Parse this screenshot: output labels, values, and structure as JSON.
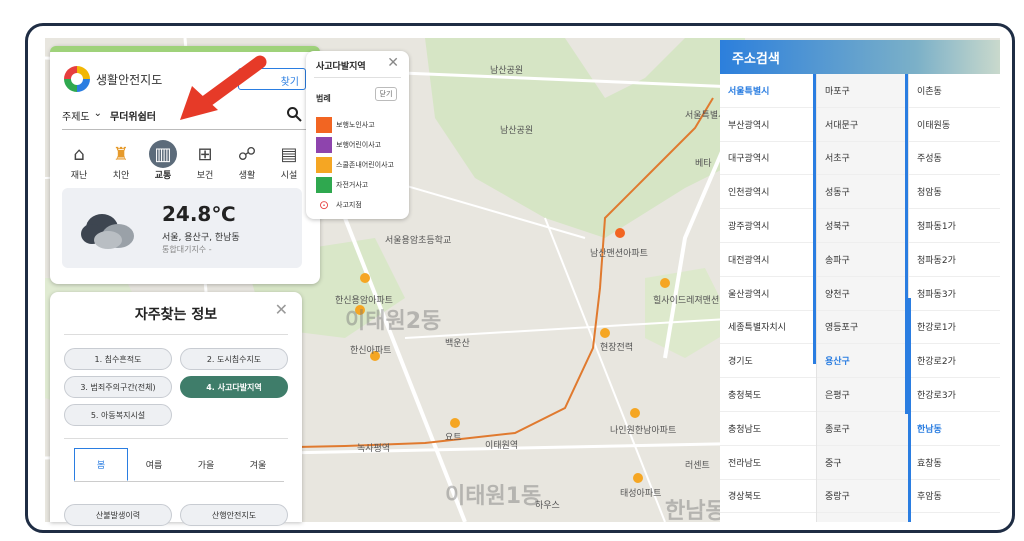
{
  "map": {
    "labels": [
      {
        "text": "남산공원"
      },
      {
        "text": "남산공원"
      },
      {
        "text": "서울특별시"
      },
      {
        "text": "베타"
      },
      {
        "text": "서울용암초등학교"
      },
      {
        "text": "남산맨션아파트"
      },
      {
        "text": "힐사이드레져맨션"
      },
      {
        "text": "한신용암아파트"
      },
      {
        "text": "이태원2동"
      },
      {
        "text": "백운산"
      },
      {
        "text": "한신아파트"
      },
      {
        "text": "현장전력"
      },
      {
        "text": "녹사평역"
      },
      {
        "text": "이태원역"
      },
      {
        "text": "요트"
      },
      {
        "text": "나인원한남아파트"
      },
      {
        "text": "이태원1동"
      },
      {
        "text": "태성아파트"
      },
      {
        "text": "하우스"
      },
      {
        "text": "한남동"
      },
      {
        "text": "러센트"
      }
    ]
  },
  "top_panel": {
    "logo_text": "생활안전지도",
    "button_label": "찾기",
    "search_category": "주제도",
    "search_value": "무더위쉼터",
    "categories": [
      {
        "label": "재난",
        "icon": "house-icon"
      },
      {
        "label": "치안",
        "icon": "siren-icon"
      },
      {
        "label": "교통",
        "icon": "road-icon"
      },
      {
        "label": "보건",
        "icon": "medkit-icon"
      },
      {
        "label": "생활",
        "icon": "hiker-icon"
      },
      {
        "label": "시설",
        "icon": "building-icon"
      }
    ],
    "weather": {
      "temperature": "24.8℃",
      "location": "서울, 용산구, 한남동",
      "air_quality": "통합대기지수  -"
    }
  },
  "legend_panel": {
    "title": "사고다발지역",
    "subtitle": "범례",
    "hide_label": "닫기",
    "items": [
      {
        "label": "보행노인사고",
        "color": "#f26522"
      },
      {
        "label": "보행어린이사고",
        "color": "#8e44ad"
      },
      {
        "label": "스쿨존내어린이사고",
        "color": "#f5a623"
      },
      {
        "label": "자전거사고",
        "color": "#2fa84f"
      },
      {
        "label": "사고지점",
        "color": "#e63e3e"
      }
    ]
  },
  "frequent_panel": {
    "title": "자주찾는 정보",
    "pills": [
      {
        "label": "1. 침수흔적도"
      },
      {
        "label": "2. 도시침수지도"
      },
      {
        "label": "3. 범죄주의구간(전체)"
      },
      {
        "label": "4. 사고다발지역"
      },
      {
        "label": "5. 아동복지시설"
      }
    ],
    "seasons": [
      "봄",
      "여름",
      "가을",
      "겨울"
    ],
    "bottom_pills": [
      {
        "label": "산불발생이력"
      },
      {
        "label": "산행안전지도"
      }
    ]
  },
  "address_panel": {
    "title": "주소검색",
    "col1": [
      "서울특별시",
      "부산광역시",
      "대구광역시",
      "인천광역시",
      "광주광역시",
      "대전광역시",
      "울산광역시",
      "세종특별자치시",
      "경기도",
      "충청북도",
      "충청남도",
      "전라남도",
      "경상북도"
    ],
    "col1_selected": "서울특별시",
    "col2": [
      "마포구",
      "서대문구",
      "서초구",
      "성동구",
      "성북구",
      "송파구",
      "양천구",
      "영등포구",
      "용산구",
      "은평구",
      "종로구",
      "중구",
      "중랑구"
    ],
    "col2_selected": "용산구",
    "col3": [
      "이촌동",
      "이태원동",
      "주성동",
      "청암동",
      "청파동1가",
      "청파동2가",
      "청파동3가",
      "한강로1가",
      "한강로2가",
      "한강로3가",
      "한남동",
      "효창동",
      "후암동"
    ],
    "col3_selected": "한남동"
  },
  "colors": {
    "accent": "#2a7de1",
    "active_pill": "#3f7d6a",
    "arrow": "#e63a28"
  }
}
